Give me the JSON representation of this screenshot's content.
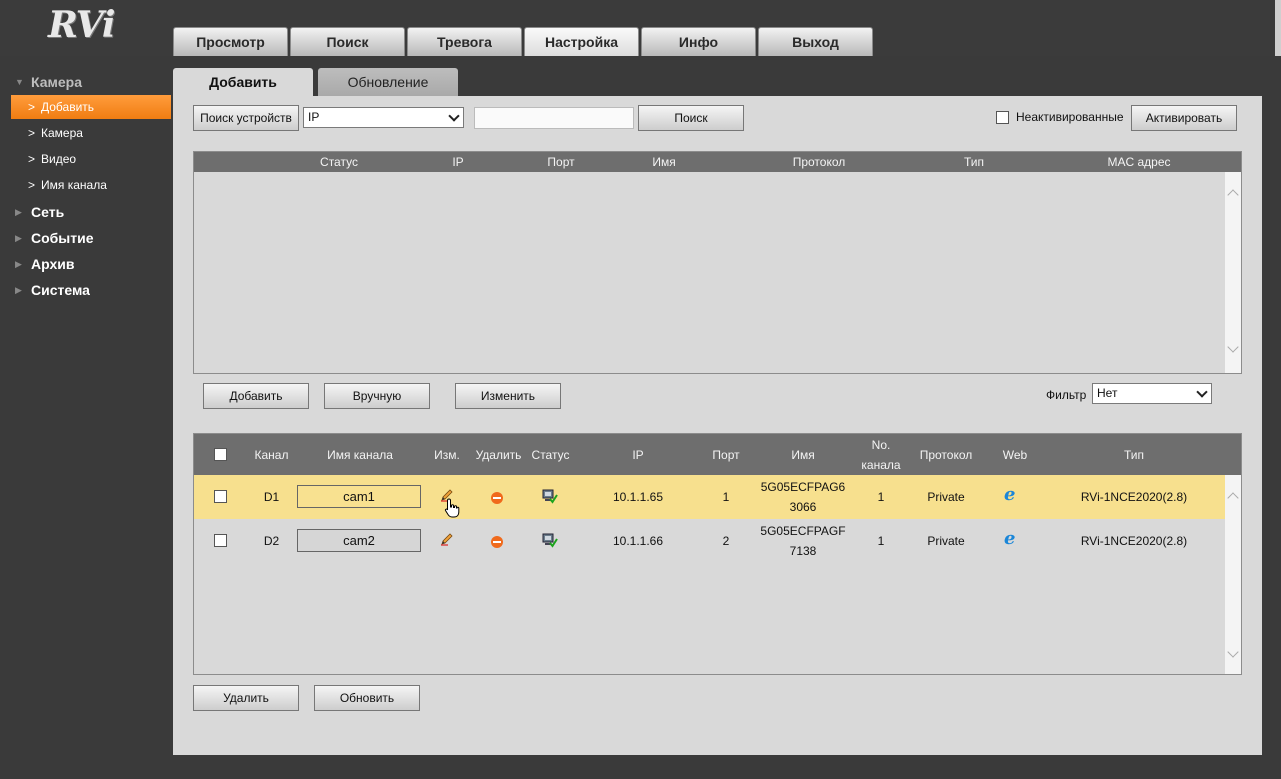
{
  "brand": {
    "logo_text": "RVi"
  },
  "topnav": [
    {
      "label": "Просмотр"
    },
    {
      "label": "Поиск"
    },
    {
      "label": "Тревога"
    },
    {
      "label": "Настройка",
      "active": true
    },
    {
      "label": "Инфо"
    },
    {
      "label": "Выход"
    }
  ],
  "sidebar": {
    "camera_group": "Камера",
    "camera_items": [
      "Добавить",
      "Камера",
      "Видео",
      "Имя канала"
    ],
    "active_item": "Добавить",
    "groups": [
      "Сеть",
      "Событие",
      "Архив",
      "Система"
    ]
  },
  "subtabs": {
    "add": "Добавить",
    "update": "Обновление"
  },
  "search_bar": {
    "search_devices_label": "Поиск устройств",
    "type_select_value": "IP",
    "search_input_value": "",
    "search_label": "Поиск",
    "inactive_label": "Неактивированные",
    "activate_label": "Активировать"
  },
  "found_table": {
    "columns": [
      "Статус",
      "IP",
      "Порт",
      "Имя",
      "Протокол",
      "Тип",
      "MAC адрес"
    ],
    "rows": []
  },
  "actions": {
    "add_label": "Добавить",
    "manual_label": "Вручную",
    "edit_label": "Изменить",
    "filter_label": "Фильтр",
    "filter_value": "Нет"
  },
  "added_table": {
    "columns": {
      "channel": "Канал",
      "channel_name": "Имя канала",
      "edit": "Изм.",
      "delete": "Удалить",
      "status": "Статус",
      "ip": "IP",
      "port": "Порт",
      "name": "Имя",
      "channel_no_1": "No.",
      "channel_no_2": "канала",
      "protocol": "Протокол",
      "web": "Web",
      "type": "Тип"
    },
    "rows": [
      {
        "channel": "D1",
        "channel_name": "cam1",
        "ip": "10.1.1.65",
        "port": "1",
        "name_1": "5G05ECFPAG6",
        "name_2": "3066",
        "channel_no": "1",
        "protocol": "Private",
        "type": "RVi-1NCE2020(2.8)",
        "highlighted": true
      },
      {
        "channel": "D2",
        "channel_name": "cam2",
        "ip": "10.1.1.66",
        "port": "2",
        "name_1": "5G05ECFPAGF",
        "name_2": "7138",
        "channel_no": "1",
        "protocol": "Private",
        "type": "RVi-1NCE2020(2.8)",
        "highlighted": false
      }
    ]
  },
  "bottom_actions": {
    "delete_label": "Удалить",
    "refresh_label": "Обновить"
  },
  "colors": {
    "accent": "#f58a20",
    "highlight_row": "#f7e08e",
    "header_bg": "#6e6e6e"
  }
}
